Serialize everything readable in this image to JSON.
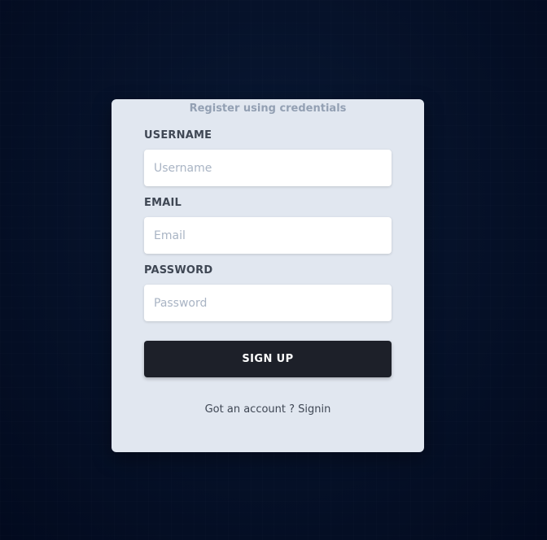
{
  "card": {
    "heading": "Register using credentials"
  },
  "fields": {
    "username": {
      "label": "USERNAME",
      "placeholder": "Username",
      "value": ""
    },
    "email": {
      "label": "EMAIL",
      "placeholder": "Email",
      "value": ""
    },
    "password": {
      "label": "PASSWORD",
      "placeholder": "Password",
      "value": ""
    }
  },
  "actions": {
    "signup_label": "SIGN UP"
  },
  "footer": {
    "prompt": "Got an account ? ",
    "link_label": "Signin"
  },
  "colors": {
    "background": "#06122a",
    "card": "#e1e7f0",
    "button": "#1d2029",
    "heading": "#93a0b3",
    "label": "#3f4754"
  }
}
